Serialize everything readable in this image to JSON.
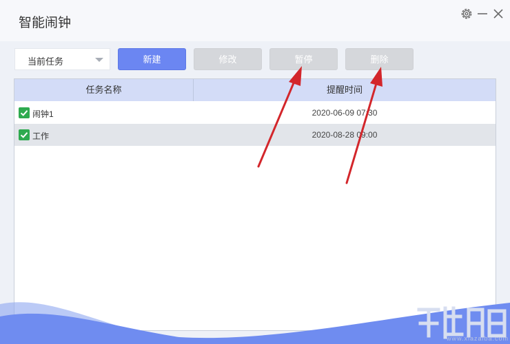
{
  "window": {
    "title": "智能闹钟"
  },
  "toolbar": {
    "task_filter": {
      "selected": "当前任务"
    },
    "new_label": "新建",
    "edit_label": "修改",
    "pause_label": "暂停",
    "delete_label": "删除"
  },
  "table": {
    "columns": [
      "任务名称",
      "提醒时间"
    ],
    "rows": [
      {
        "checked": true,
        "name": "闹钟1",
        "time": "2020-06-09 07:30"
      },
      {
        "checked": true,
        "name": "工作",
        "time": "2020-08-28 09:00"
      }
    ]
  },
  "watermark": {
    "url": "www.xiazaiba.com"
  },
  "colors": {
    "accent": "#6b86f2",
    "disabled_button": "#d5d7db",
    "header_bg": "#d3dcf7",
    "checkbox": "#2eaa4f",
    "annotation_arrow": "#d3262b"
  }
}
